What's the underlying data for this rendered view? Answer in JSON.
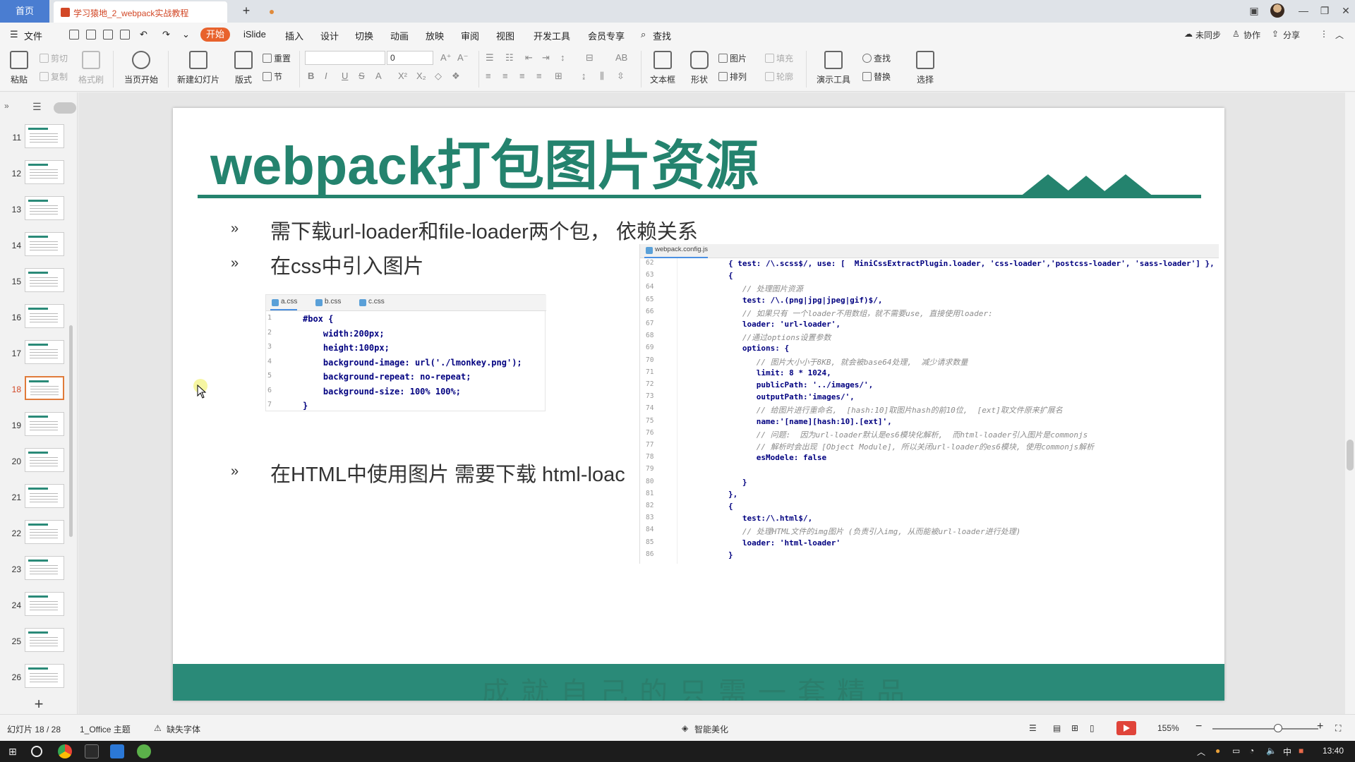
{
  "tabs": {
    "home": "首页",
    "document": "学习猿地_2_webpack实战教程",
    "new_tab": "+"
  },
  "menu": {
    "file": "文件",
    "start": "开始",
    "items": [
      "iSlide",
      "插入",
      "设计",
      "切换",
      "动画",
      "放映",
      "审阅",
      "视图",
      "开发工具",
      "会员专享"
    ],
    "search": "查找",
    "right": [
      "未同步",
      "协作",
      "分享"
    ]
  },
  "ribbon": {
    "paste": "粘贴",
    "cut": "剪切",
    "copy": "复制",
    "format_painter": "格式刷",
    "play_current": "当页开始",
    "new_slide": "新建幻灯片",
    "layout": "版式",
    "reset": "重置",
    "section": "节",
    "font_size": "0",
    "textbox": "文本框",
    "shape": "形状",
    "picture": "图片",
    "fill": "填充",
    "arrange": "排列",
    "outline": "轮廓",
    "presenter_tools": "演示工具",
    "find": "查找",
    "replace": "替换",
    "select": "选择"
  },
  "slides_panel": {
    "numbers": [
      "11",
      "12",
      "13",
      "14",
      "15",
      "16",
      "17",
      "18",
      "19",
      "20",
      "21",
      "22",
      "23",
      "24",
      "25",
      "26"
    ],
    "active": "18",
    "add": "+"
  },
  "slide": {
    "title": "webpack打包图片资源",
    "bullet_symbol": "»",
    "bullets": [
      "需下载url-loader和file-loader两个包， 依赖关系",
      "在css中引入图片",
      "在HTML中使用图片 需要下载 html-loac"
    ],
    "css_tabs": [
      "a.css",
      "b.css",
      "c.css"
    ],
    "css_lines": [
      {
        "n": "1",
        "code": "#box {"
      },
      {
        "n": "2",
        "code": "    width:200px;"
      },
      {
        "n": "3",
        "code": "    height:100px;"
      },
      {
        "n": "4",
        "code": "    background-image: url('./lmonkey.png');"
      },
      {
        "n": "5",
        "code": "    background-repeat: no-repeat;"
      },
      {
        "n": "6",
        "code": "    background-size: 100% 100%;"
      },
      {
        "n": "7",
        "code": "}"
      }
    ],
    "config_tab": "webpack.config.js",
    "config_lines": [
      {
        "n": "62",
        "code": "{ test: /\\.scss$/, use: [  MiniCssExtractPlugin.loader, 'css-loader','postcss-loader', 'sass-loader'] },",
        "comment": false
      },
      {
        "n": "63",
        "code": "{",
        "comment": false
      },
      {
        "n": "64",
        "code": "   // 处理图片资源",
        "comment": true
      },
      {
        "n": "65",
        "code": "   test: /\\.(png|jpg|jpeg|gif)$/,",
        "comment": false
      },
      {
        "n": "66",
        "code": "   // 如果只有 一个loader不用数组，就不需要use, 直接使用loader:",
        "comment": true
      },
      {
        "n": "67",
        "code": "   loader: 'url-loader',",
        "comment": false
      },
      {
        "n": "68",
        "code": "   //通过options设置参数",
        "comment": true
      },
      {
        "n": "69",
        "code": "   options: {",
        "comment": false
      },
      {
        "n": "70",
        "code": "      // 图片大小小于8KB, 就会被base64处理,  减少请求数量",
        "comment": true
      },
      {
        "n": "71",
        "code": "      limit: 8 * 1024,",
        "comment": false
      },
      {
        "n": "72",
        "code": "      publicPath: '../images/',",
        "comment": false
      },
      {
        "n": "73",
        "code": "      outputPath:'images/',",
        "comment": false
      },
      {
        "n": "74",
        "code": "      // 给图片进行重命名,  [hash:10]取图片hash的前10位,  [ext]取文件原来扩展名",
        "comment": true
      },
      {
        "n": "75",
        "code": "      name:'[name][hash:10].[ext]',",
        "comment": false
      },
      {
        "n": "76",
        "code": "      // 问题:  因为url-loader默认是es6模块化解析,  而html-loader引入图片是commonjs",
        "comment": true
      },
      {
        "n": "77",
        "code": "      // 解析时会出现 [Object Module], 所以关闭url-loader的es6模块, 使用commonjs解析",
        "comment": true
      },
      {
        "n": "78",
        "code": "      esModele: false",
        "comment": false
      },
      {
        "n": "79",
        "code": "",
        "comment": false
      },
      {
        "n": "80",
        "code": "   }",
        "comment": false
      },
      {
        "n": "81",
        "code": "},",
        "comment": false
      },
      {
        "n": "82",
        "code": "{",
        "comment": false
      },
      {
        "n": "83",
        "code": "   test:/\\.html$/,",
        "comment": false
      },
      {
        "n": "84",
        "code": "   // 处理HTML文件的img图片 (负责引入img, 从而能被url-loader进行处理)",
        "comment": true
      },
      {
        "n": "85",
        "code": "   loader: 'html-loader'",
        "comment": false
      },
      {
        "n": "86",
        "code": "}",
        "comment": false
      }
    ],
    "footer": "成就自己的只需一套精品"
  },
  "statusbar": {
    "slide_info": "幻灯片 18 / 28",
    "theme": "1_Office 主题",
    "missing_font": "缺失字体",
    "beautify": "智能美化",
    "zoom": "155%",
    "zoom_level": 0.62
  },
  "taskbar": {
    "time": "13:40",
    "ime": "中"
  },
  "colors": {
    "accent": "#24836e",
    "home_tab": "#4a7dd1",
    "start_menu": "#e8622c",
    "footer": "#2a8a78"
  }
}
